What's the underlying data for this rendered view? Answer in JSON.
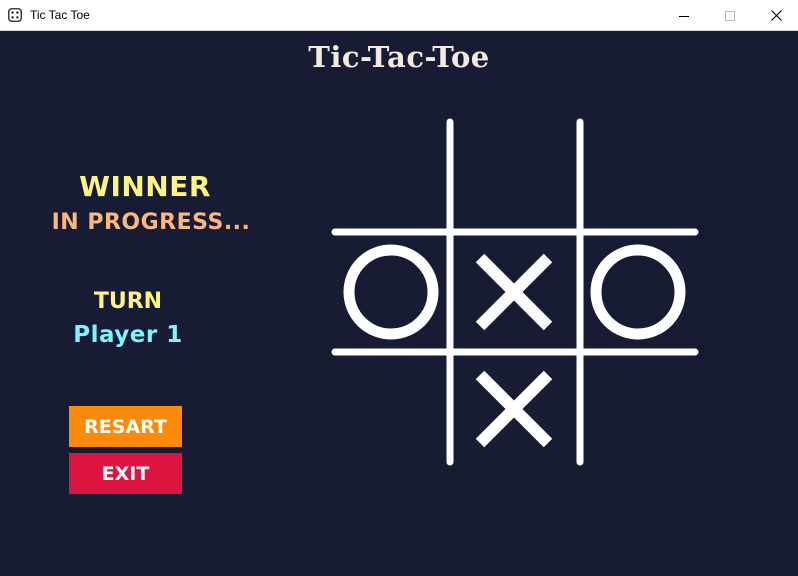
{
  "window": {
    "title": "Tic Tac Toe",
    "controls": [
      "minimize",
      "maximize",
      "close"
    ]
  },
  "game": {
    "title": "Tic-Tac-Toe",
    "winner_label": "WINNER",
    "winner_status": "IN PROGRESS...",
    "turn_label": "TURN",
    "turn_player": "Player 1",
    "restart_label": "RESART",
    "exit_label": "EXIT",
    "board": [
      [
        "",
        "",
        ""
      ],
      [
        "O",
        "X",
        "O"
      ],
      [
        "",
        "X",
        ""
      ]
    ]
  },
  "colors": {
    "background": "#171b33",
    "title": "#f3ebe2",
    "winner_label": "#fdf381",
    "winner_status": "#fcb77d",
    "turn_label": "#fdf381",
    "turn_player": "#7ff2ff",
    "restart_button": "#fd8a09",
    "exit_button": "#db153f",
    "grid": "#ffffff"
  }
}
